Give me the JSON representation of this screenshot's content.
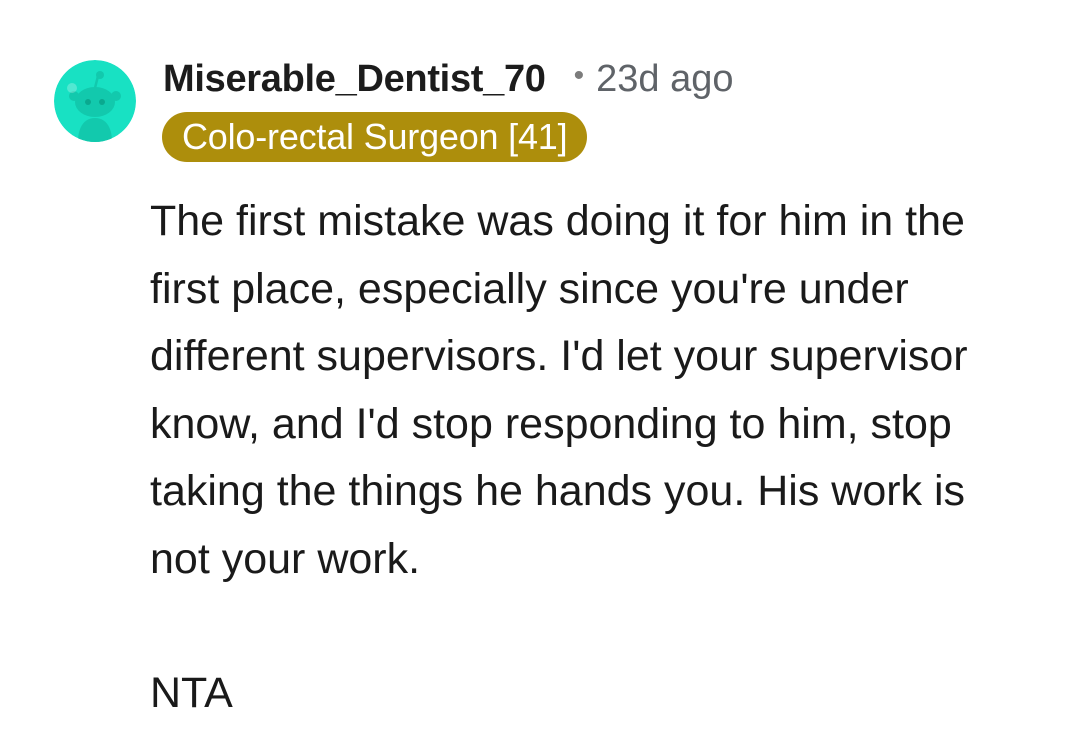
{
  "comment": {
    "avatar_icon": "reddit-snoo-icon",
    "avatar_color": "#18e1c3",
    "username": "Miserable_Dentist_70",
    "separator": "•",
    "timestamp": "23d ago",
    "flair": "Colo-rectal Surgeon [41]",
    "flair_color": "#ad8e0c",
    "paragraphs": [
      "The first mistake was doing it for him in the first place, especially since you're under different supervisors. I'd let your supervisor know, and I'd stop responding to him, stop taking the things he hands you. His work is not your work.",
      "NTA"
    ]
  }
}
